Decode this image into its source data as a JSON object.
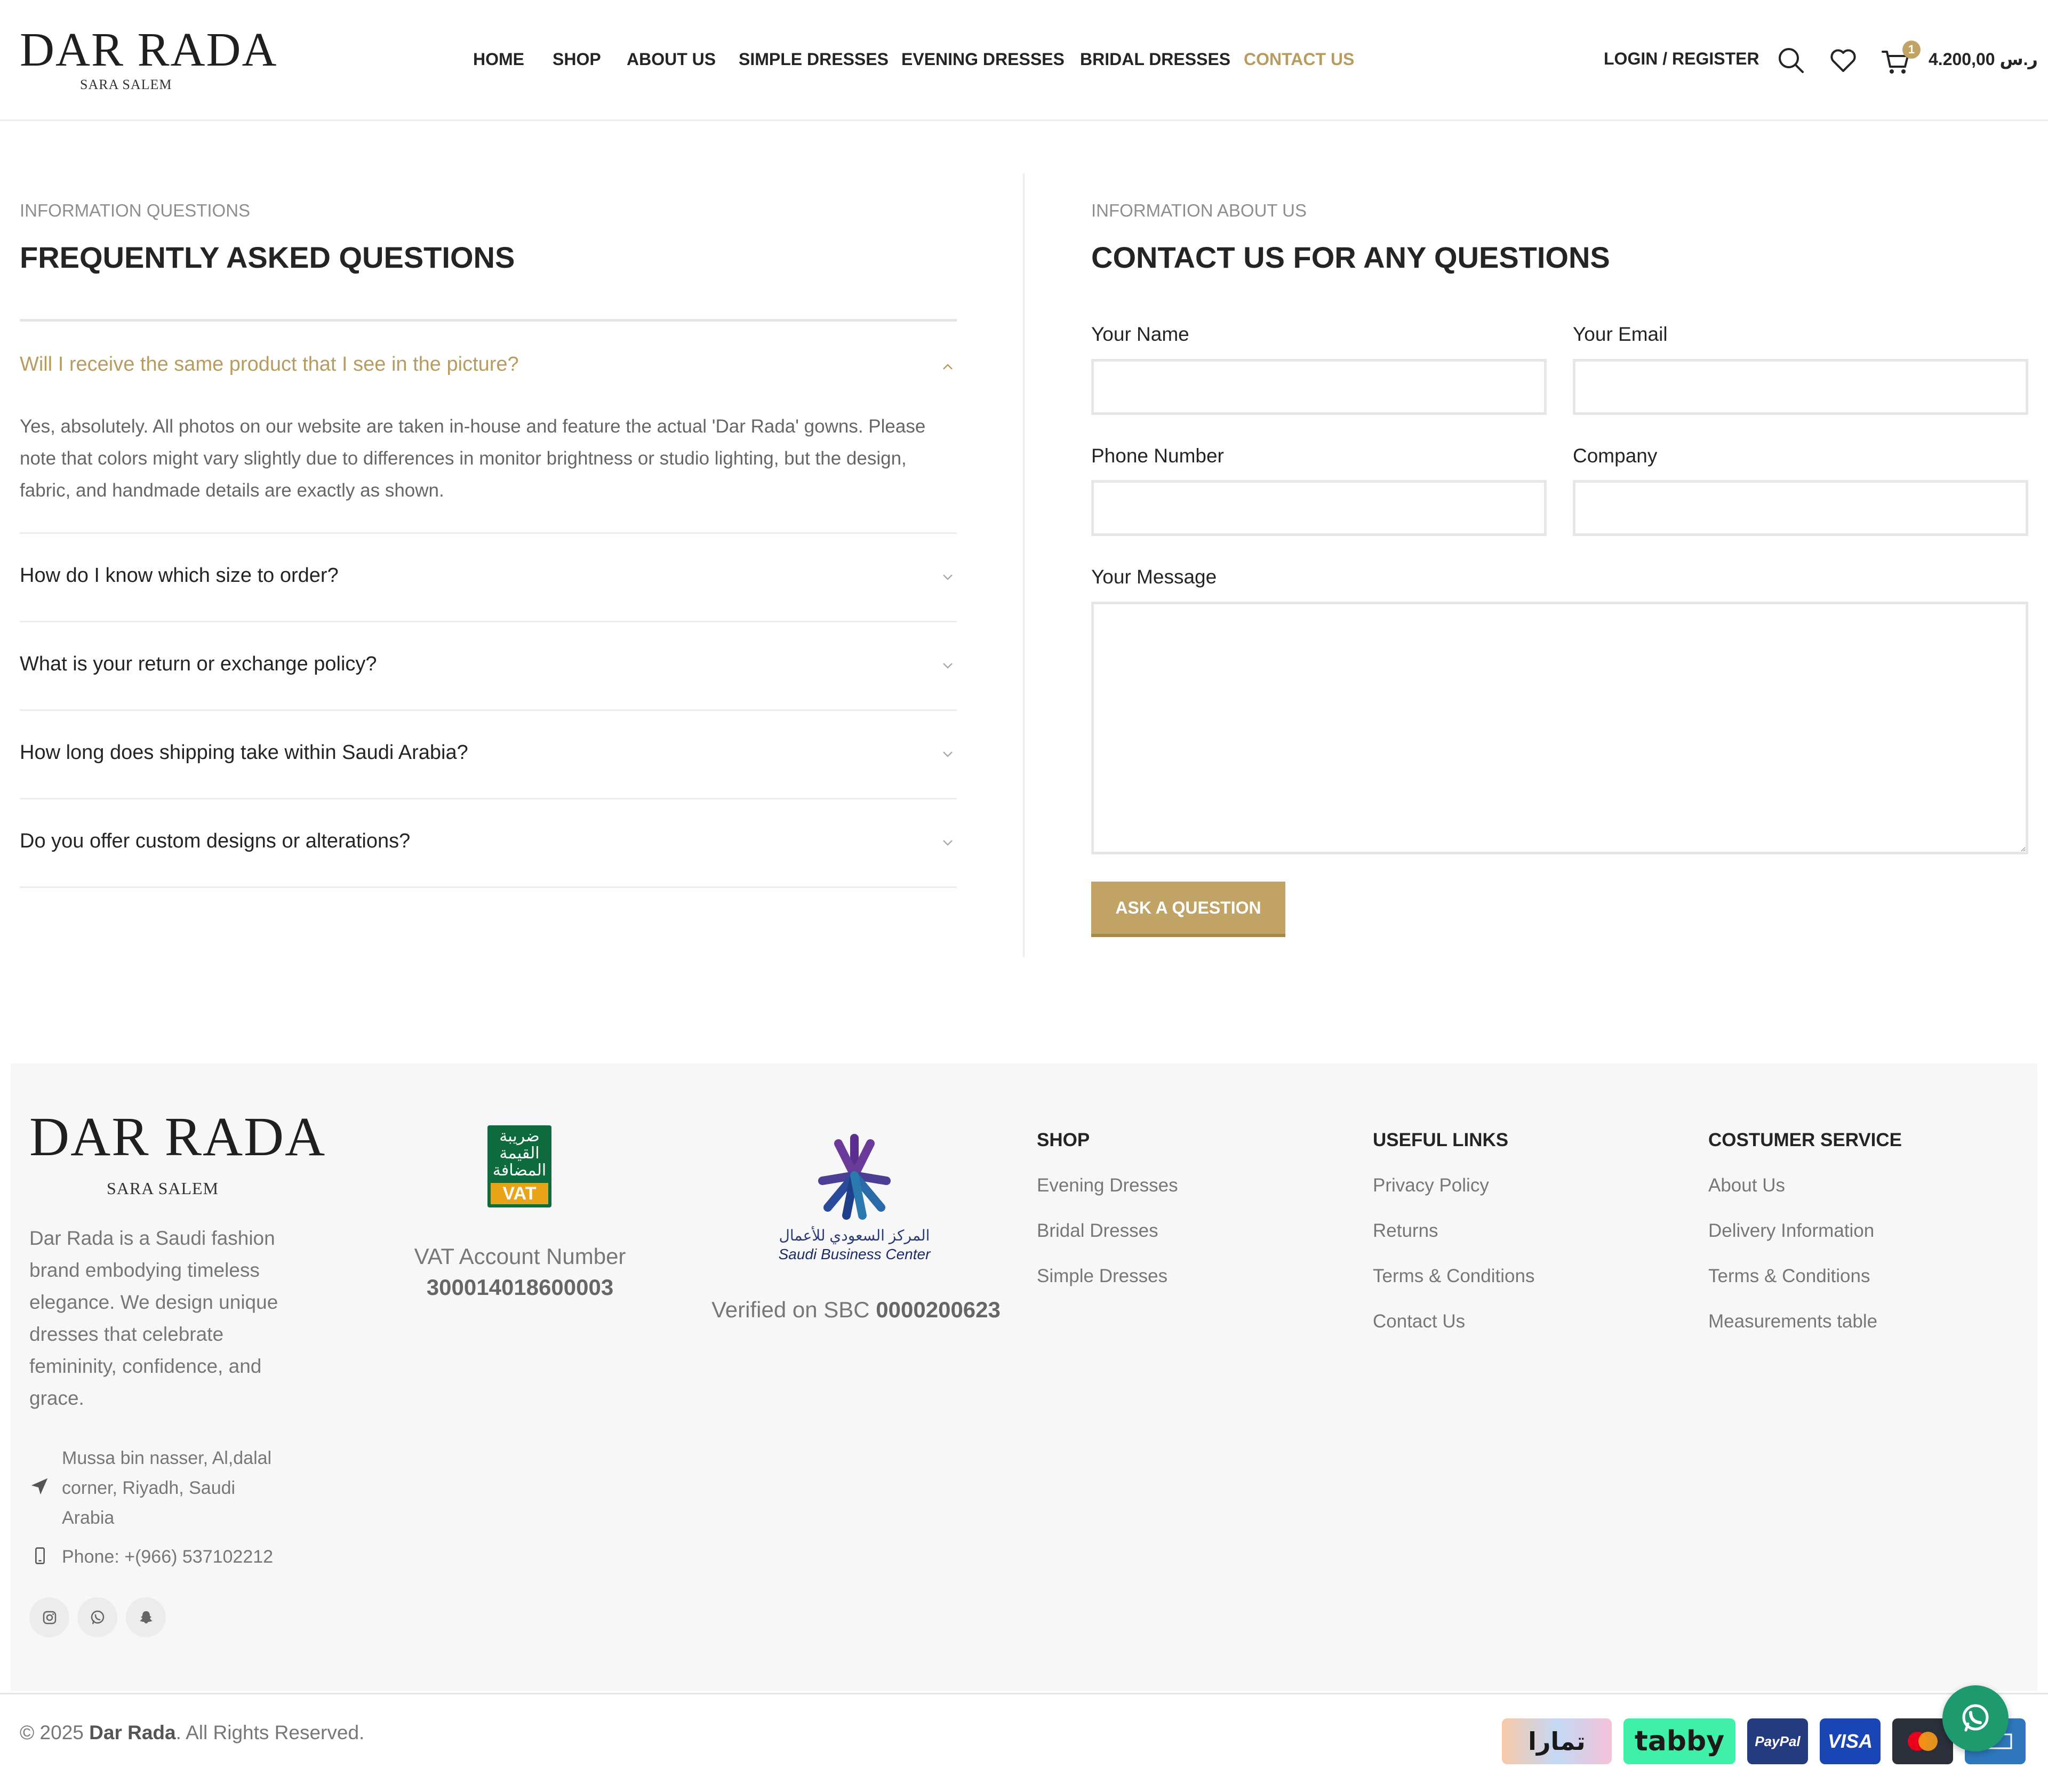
{
  "header": {
    "logo_main": "DAR RADA",
    "logo_sub": "SARA SALEM",
    "nav": [
      "HOME",
      "SHOP",
      "ABOUT US",
      "SIMPLE DRESSES",
      "EVENING DRESSES",
      "BRIDAL DRESSES",
      "CONTACT US"
    ],
    "active_nav": "CONTACT US",
    "login_label": "LOGIN / REGISTER",
    "cart_count": "1",
    "cart_total": "4.200,00",
    "currency": "ر.س",
    "icons": [
      "search-icon",
      "heart-icon",
      "cart-icon"
    ]
  },
  "faq": {
    "eyebrow": "INFORMATION QUESTIONS",
    "title": "FREQUENTLY ASKED QUESTIONS",
    "items": [
      {
        "question": "Will I receive the same product that I see in the picture?",
        "answer": "Yes, absolutely. All photos on our website are taken in-house and feature the actual 'Dar Rada' gowns. Please note that colors might vary slightly due to differences in monitor brightness or studio lighting, but the design, fabric, and handmade details are exactly as shown.",
        "open": true
      },
      {
        "question": "How do I know which size to order?",
        "open": false
      },
      {
        "question": "What is your return or exchange policy?",
        "open": false
      },
      {
        "question": "How long does shipping take within Saudi Arabia?",
        "open": false
      },
      {
        "question": "Do you offer custom designs or alterations?",
        "open": false
      }
    ]
  },
  "contact": {
    "eyebrow": "INFORMATION ABOUT US",
    "title": "CONTACT US FOR ANY QUESTIONS",
    "fields": {
      "name_label": "Your Name",
      "email_label": "Your Email",
      "phone_label": "Phone Number",
      "company_label": "Company",
      "message_label": "Your Message"
    },
    "submit_label": "ASK A QUESTION"
  },
  "footer": {
    "logo_main": "DAR RADA",
    "logo_sub": "SARA SALEM",
    "about": "Dar Rada is a Saudi fashion brand embodying timeless elegance. We design unique dresses that celebrate femininity, confidence, and grace.",
    "address": "Mussa bin nasser, Al,dalal corner, Riyadh, Saudi Arabia",
    "phone": "Phone: +(966) 537102212",
    "social": [
      "instagram-icon",
      "whatsapp-icon",
      "snapchat-icon"
    ],
    "vat": {
      "badge_arabic_1": "ضريبة",
      "badge_arabic_2": "القيمة",
      "badge_arabic_3": "المضافة",
      "badge_vat": "VAT",
      "label": "VAT Account Number",
      "number": "300014018600003"
    },
    "sbc": {
      "arabic": "المركز السعودي للأعمال",
      "english": "Saudi Business Center",
      "label": "Verified on SBC",
      "number": "0000200623"
    },
    "columns": [
      {
        "title": "SHOP",
        "links": [
          "Evening Dresses",
          "Bridal Dresses",
          "Simple Dresses"
        ]
      },
      {
        "title": "USEFUL LINKS",
        "links": [
          "Privacy Policy",
          "Returns",
          "Terms & Conditions",
          "Contact Us"
        ]
      },
      {
        "title": "COSTUMER SERVICE",
        "links": [
          "About Us",
          "Delivery Information",
          "Terms & Conditions",
          "Measurements table"
        ]
      }
    ],
    "copyright_prefix": "© 2025",
    "copyright_brand": "Dar Rada",
    "copyright_suffix": ". All Rights Reserved.",
    "payments": [
      "تمارا",
      "tabby",
      "PayPal",
      "VISA",
      "mastercard-icon",
      "amex-icon"
    ]
  },
  "colors": {
    "accent": "#b89b5e",
    "button": "#c1a465",
    "whatsapp": "#1e9a6f",
    "text_dark": "#242424",
    "text_muted": "#777777"
  }
}
